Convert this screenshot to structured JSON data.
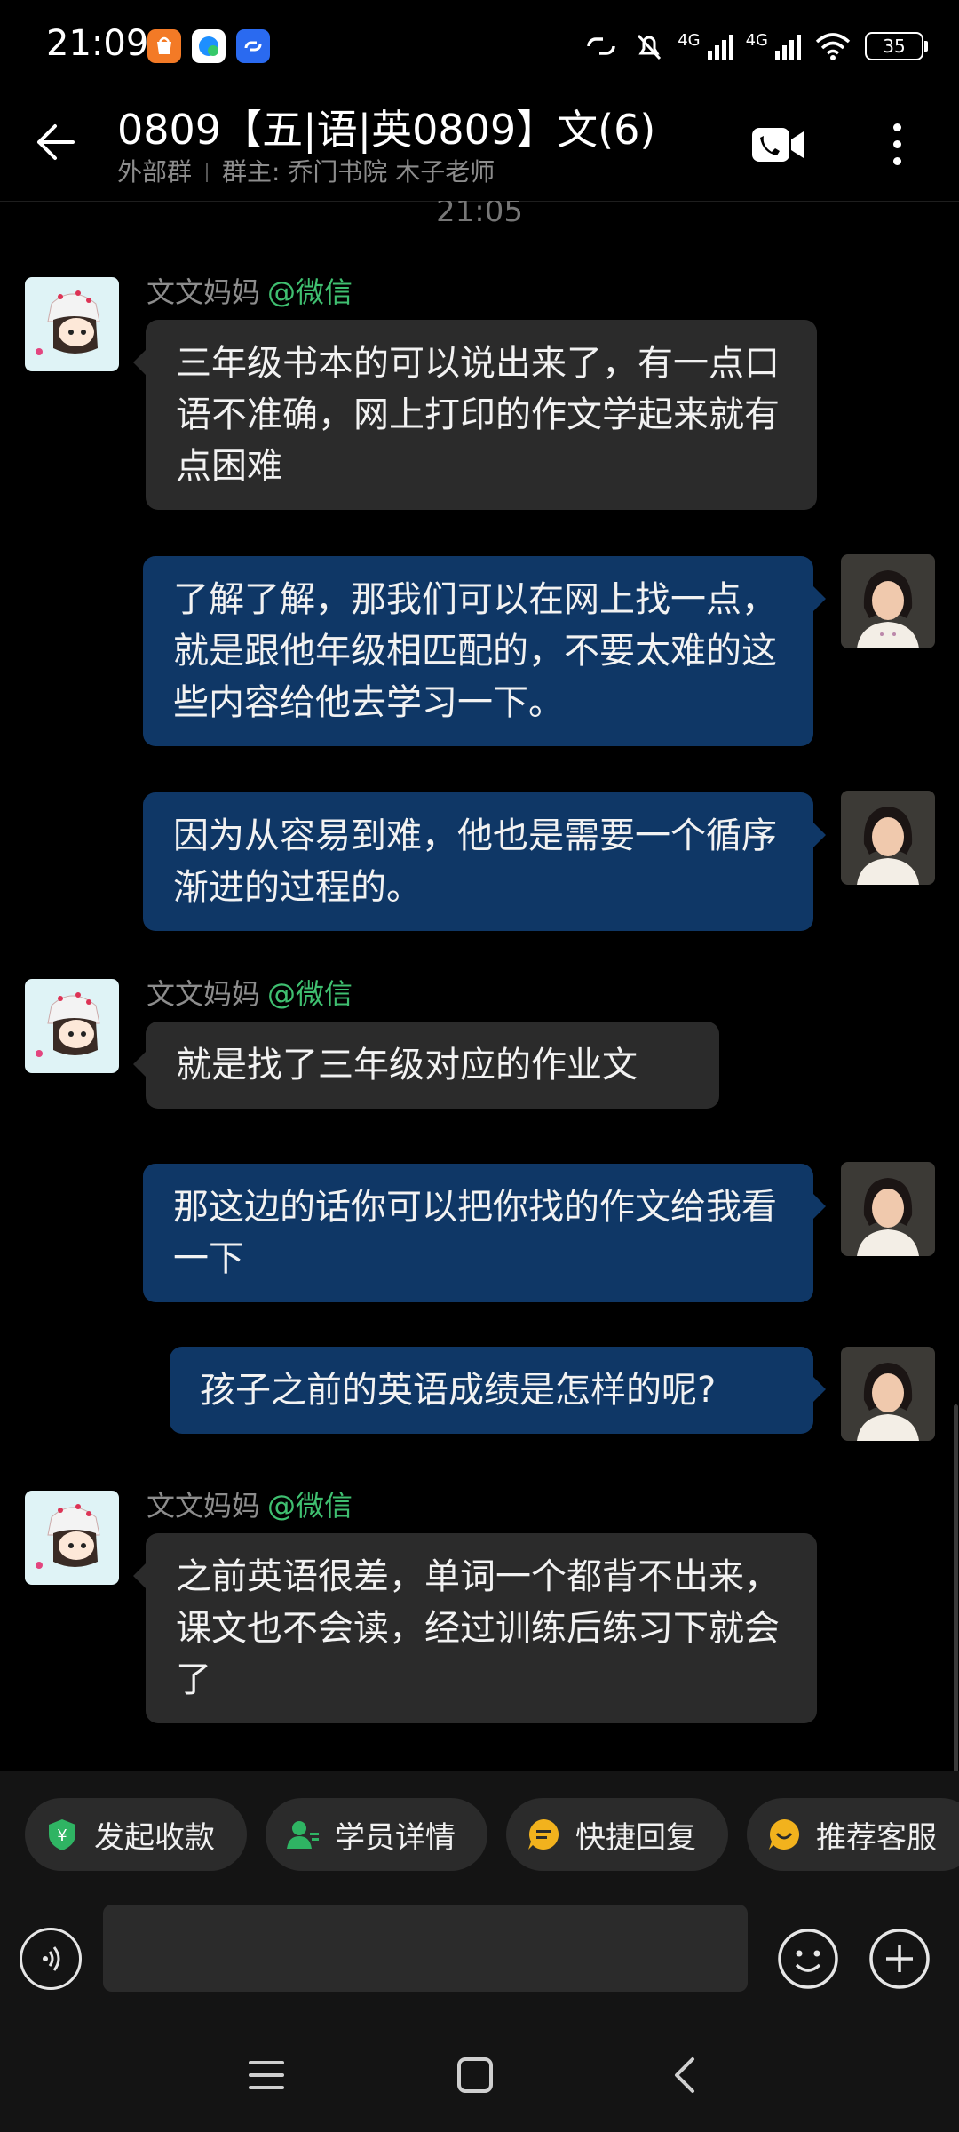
{
  "status_bar": {
    "time": "21:09",
    "net1": "4G",
    "net2": "4G",
    "battery": "35",
    "icons": [
      "taobao-app-icon",
      "messaging-app-icon",
      "link-app-icon",
      "hotspot-icon",
      "mute-bell-icon",
      "signal-icon",
      "wifi-icon",
      "battery-icon"
    ]
  },
  "header": {
    "title": "0809【五|语|英0809】文(6)",
    "group_type": "外部群",
    "owner": "群主: 乔门书院 木子老师",
    "icons": [
      "back-arrow-icon",
      "video-call-icon",
      "more-vertical-icon"
    ]
  },
  "conversation": {
    "timestamp": "21:05",
    "sender_name": "文文妈妈",
    "sender_tag": "@微信",
    "messages": [
      {
        "from": "in",
        "text": "三年级书本的可以说出来了，有一点口语不准确，网上打印的作文学起来就有点困难"
      },
      {
        "from": "out",
        "text": "了解了解，那我们可以在网上找一点，就是跟他年级相匹配的，不要太难的这些内容给他去学习一下。"
      },
      {
        "from": "out",
        "text": "因为从容易到难，他也是需要一个循序渐进的过程的。"
      },
      {
        "from": "in",
        "text": "就是找了三年级对应的作业文"
      },
      {
        "from": "out",
        "text": "那这边的话你可以把你找的作文给我看一下"
      },
      {
        "from": "out",
        "text": "孩子之前的英语成绩是怎样的呢?"
      },
      {
        "from": "in",
        "text": "之前英语很差，单词一个都背不出来，课文也不会读，经过训练后练习下就会了"
      }
    ]
  },
  "quick_actions": [
    {
      "label": "发起收款",
      "icon": "payment-shield-icon",
      "color": "#2fb463"
    },
    {
      "label": "学员详情",
      "icon": "student-profile-icon",
      "color": "#2fb463"
    },
    {
      "label": "快捷回复",
      "icon": "quick-reply-icon",
      "color": "#f2b21d"
    },
    {
      "label": "推荐客服",
      "icon": "recommend-service-icon",
      "color": "#f2b21d"
    }
  ],
  "input": {
    "value": "",
    "icons": [
      "voice-input-icon",
      "emoji-icon",
      "add-plus-icon"
    ]
  },
  "nav_bar": {
    "icons": [
      "menu-icon",
      "home-square-icon",
      "back-chevron-icon"
    ]
  },
  "colors": {
    "background": "#000000",
    "incoming_bubble": "#2b2b2b",
    "outgoing_bubble": "#0f3766",
    "tag_green": "#3fbf70"
  }
}
